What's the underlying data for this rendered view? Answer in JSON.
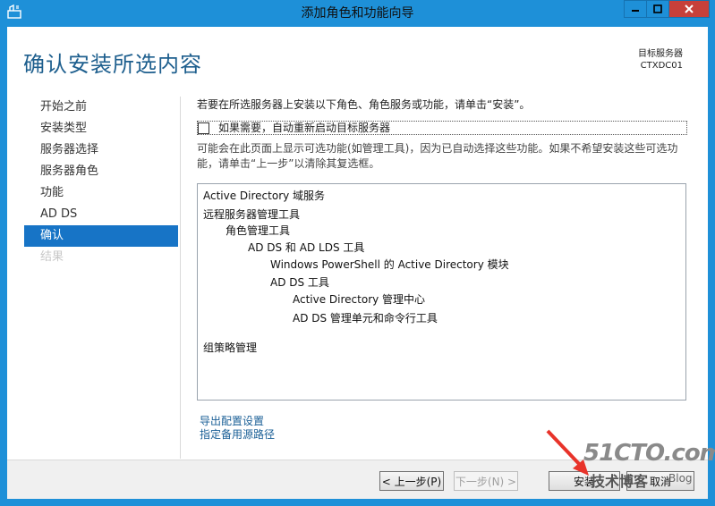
{
  "window": {
    "title": "添加角色和功能向导"
  },
  "page": {
    "title": "确认安装所选内容",
    "target_label": "目标服务器",
    "target_value": "CTXDC01"
  },
  "nav": {
    "items": [
      {
        "label": "开始之前",
        "state": "normal"
      },
      {
        "label": "安装类型",
        "state": "normal"
      },
      {
        "label": "服务器选择",
        "state": "normal"
      },
      {
        "label": "服务器角色",
        "state": "normal"
      },
      {
        "label": "功能",
        "state": "normal"
      },
      {
        "label": "AD DS",
        "state": "normal"
      },
      {
        "label": "确认",
        "state": "selected"
      },
      {
        "label": "结果",
        "state": "disabled"
      }
    ]
  },
  "content": {
    "intro": "若要在所选服务器上安装以下角色、角色服务或功能，请单击“安装”。",
    "restart_label": "如果需要，自动重新启动目标服务器",
    "note": "可能会在此页面上显示可选功能(如管理工具)，因为已自动选择这些功能。如果不希望安装这些可选功能，请单击“上一步”以清除其复选框。",
    "features": [
      "Active Directory 域服务",
      "远程服务器管理工具",
      "角色管理工具",
      "AD DS 和 AD LDS 工具",
      "Windows PowerShell 的 Active Directory 模块",
      "AD DS 工具",
      "Active Directory 管理中心",
      "AD DS 管理单元和命令行工具",
      "组策略管理"
    ],
    "links": {
      "export": "导出配置设置",
      "alt_source": "指定备用源路径"
    }
  },
  "footer": {
    "prev": "< 上一步(P)",
    "next": "下一步(N) >",
    "install": "安装",
    "cancel": "取消"
  },
  "watermark": {
    "main": "51CTO.com",
    "sub": "技术博客",
    "blog": "Blog"
  },
  "colors": {
    "accent": "#1774c6",
    "title_blue": "#1e5f8e",
    "frame": "#1e90d8",
    "close": "#c7403a",
    "arrow": "#e8332a"
  }
}
